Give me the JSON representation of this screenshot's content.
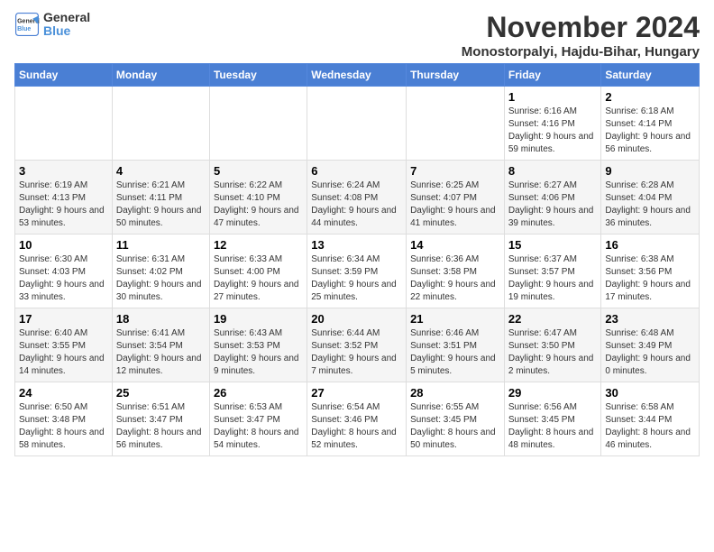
{
  "logo": {
    "general": "General",
    "blue": "Blue"
  },
  "title": "November 2024",
  "location": "Monostorpalyi, Hajdu-Bihar, Hungary",
  "weekdays": [
    "Sunday",
    "Monday",
    "Tuesday",
    "Wednesday",
    "Thursday",
    "Friday",
    "Saturday"
  ],
  "weeks": [
    [
      {
        "day": "",
        "info": ""
      },
      {
        "day": "",
        "info": ""
      },
      {
        "day": "",
        "info": ""
      },
      {
        "day": "",
        "info": ""
      },
      {
        "day": "",
        "info": ""
      },
      {
        "day": "1",
        "info": "Sunrise: 6:16 AM\nSunset: 4:16 PM\nDaylight: 9 hours and 59 minutes."
      },
      {
        "day": "2",
        "info": "Sunrise: 6:18 AM\nSunset: 4:14 PM\nDaylight: 9 hours and 56 minutes."
      }
    ],
    [
      {
        "day": "3",
        "info": "Sunrise: 6:19 AM\nSunset: 4:13 PM\nDaylight: 9 hours and 53 minutes."
      },
      {
        "day": "4",
        "info": "Sunrise: 6:21 AM\nSunset: 4:11 PM\nDaylight: 9 hours and 50 minutes."
      },
      {
        "day": "5",
        "info": "Sunrise: 6:22 AM\nSunset: 4:10 PM\nDaylight: 9 hours and 47 minutes."
      },
      {
        "day": "6",
        "info": "Sunrise: 6:24 AM\nSunset: 4:08 PM\nDaylight: 9 hours and 44 minutes."
      },
      {
        "day": "7",
        "info": "Sunrise: 6:25 AM\nSunset: 4:07 PM\nDaylight: 9 hours and 41 minutes."
      },
      {
        "day": "8",
        "info": "Sunrise: 6:27 AM\nSunset: 4:06 PM\nDaylight: 9 hours and 39 minutes."
      },
      {
        "day": "9",
        "info": "Sunrise: 6:28 AM\nSunset: 4:04 PM\nDaylight: 9 hours and 36 minutes."
      }
    ],
    [
      {
        "day": "10",
        "info": "Sunrise: 6:30 AM\nSunset: 4:03 PM\nDaylight: 9 hours and 33 minutes."
      },
      {
        "day": "11",
        "info": "Sunrise: 6:31 AM\nSunset: 4:02 PM\nDaylight: 9 hours and 30 minutes."
      },
      {
        "day": "12",
        "info": "Sunrise: 6:33 AM\nSunset: 4:00 PM\nDaylight: 9 hours and 27 minutes."
      },
      {
        "day": "13",
        "info": "Sunrise: 6:34 AM\nSunset: 3:59 PM\nDaylight: 9 hours and 25 minutes."
      },
      {
        "day": "14",
        "info": "Sunrise: 6:36 AM\nSunset: 3:58 PM\nDaylight: 9 hours and 22 minutes."
      },
      {
        "day": "15",
        "info": "Sunrise: 6:37 AM\nSunset: 3:57 PM\nDaylight: 9 hours and 19 minutes."
      },
      {
        "day": "16",
        "info": "Sunrise: 6:38 AM\nSunset: 3:56 PM\nDaylight: 9 hours and 17 minutes."
      }
    ],
    [
      {
        "day": "17",
        "info": "Sunrise: 6:40 AM\nSunset: 3:55 PM\nDaylight: 9 hours and 14 minutes."
      },
      {
        "day": "18",
        "info": "Sunrise: 6:41 AM\nSunset: 3:54 PM\nDaylight: 9 hours and 12 minutes."
      },
      {
        "day": "19",
        "info": "Sunrise: 6:43 AM\nSunset: 3:53 PM\nDaylight: 9 hours and 9 minutes."
      },
      {
        "day": "20",
        "info": "Sunrise: 6:44 AM\nSunset: 3:52 PM\nDaylight: 9 hours and 7 minutes."
      },
      {
        "day": "21",
        "info": "Sunrise: 6:46 AM\nSunset: 3:51 PM\nDaylight: 9 hours and 5 minutes."
      },
      {
        "day": "22",
        "info": "Sunrise: 6:47 AM\nSunset: 3:50 PM\nDaylight: 9 hours and 2 minutes."
      },
      {
        "day": "23",
        "info": "Sunrise: 6:48 AM\nSunset: 3:49 PM\nDaylight: 9 hours and 0 minutes."
      }
    ],
    [
      {
        "day": "24",
        "info": "Sunrise: 6:50 AM\nSunset: 3:48 PM\nDaylight: 8 hours and 58 minutes."
      },
      {
        "day": "25",
        "info": "Sunrise: 6:51 AM\nSunset: 3:47 PM\nDaylight: 8 hours and 56 minutes."
      },
      {
        "day": "26",
        "info": "Sunrise: 6:53 AM\nSunset: 3:47 PM\nDaylight: 8 hours and 54 minutes."
      },
      {
        "day": "27",
        "info": "Sunrise: 6:54 AM\nSunset: 3:46 PM\nDaylight: 8 hours and 52 minutes."
      },
      {
        "day": "28",
        "info": "Sunrise: 6:55 AM\nSunset: 3:45 PM\nDaylight: 8 hours and 50 minutes."
      },
      {
        "day": "29",
        "info": "Sunrise: 6:56 AM\nSunset: 3:45 PM\nDaylight: 8 hours and 48 minutes."
      },
      {
        "day": "30",
        "info": "Sunrise: 6:58 AM\nSunset: 3:44 PM\nDaylight: 8 hours and 46 minutes."
      }
    ]
  ]
}
